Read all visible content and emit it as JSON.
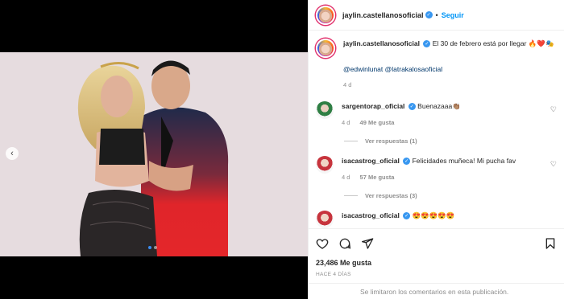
{
  "post": {
    "author": "jaylin.castellanosoficial",
    "follow_label": "Seguir",
    "caption": {
      "text": "El 30 de febrero está por llegar 🔥❤️🎭",
      "mentions": "@edwinlunat @latrakalosaoficial",
      "time": "4 d"
    },
    "likes": "23,486 Me gusta",
    "posted_ago": "HACE 4 DÍAS",
    "comments_limited": "Se limitaron los comentarios en esta publicación."
  },
  "comments": [
    {
      "user": "sargentorap_oficial",
      "text": "Buenazaaa👏🏽",
      "time": "4 d",
      "likes": "49 Me gusta",
      "replies": "Ver respuestas (1)"
    },
    {
      "user": "isacastrog_oficial",
      "text": "Felicidades muñeca! Mi pucha fav",
      "time": "4 d",
      "likes": "57 Me gusta",
      "replies": "Ver respuestas (3)"
    },
    {
      "user": "isacastrog_oficial",
      "text": "😍😍😍😍😍"
    }
  ],
  "icons": {
    "like": "heart-icon",
    "comment": "comment-icon",
    "share": "share-icon",
    "save": "bookmark-icon",
    "prev": "chevron-left-icon",
    "verified": "verified-badge-icon"
  },
  "colors": {
    "accent": "#0095f6",
    "verified": "#3897f0",
    "muted": "#8e8e8e",
    "carousel_active": "#3b8cf0"
  },
  "carousel": {
    "slides": 2,
    "active_index": 0
  }
}
